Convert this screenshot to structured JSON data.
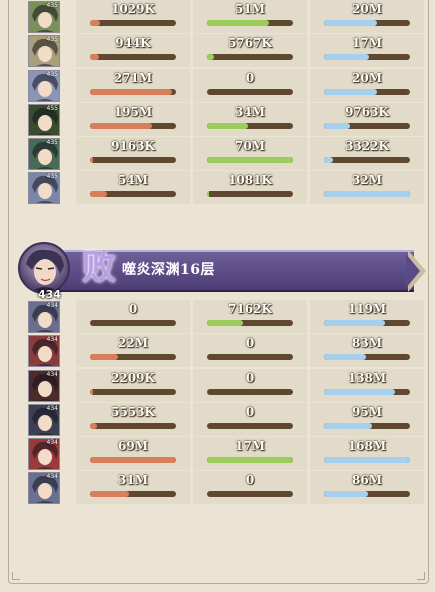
{
  "team_a": {
    "rows": [
      {
        "level": "435",
        "portrait_color": "#7b8f5a",
        "damage": {
          "value": "1029K",
          "fraction": 0.12
        },
        "healing": {
          "value": "51M",
          "fraction": 0.72
        },
        "taken": {
          "value": "20M",
          "fraction": 0.62
        }
      },
      {
        "level": "435",
        "portrait_color": "#a9a07a",
        "damage": {
          "value": "944K",
          "fraction": 0.1
        },
        "healing": {
          "value": "5767K",
          "fraction": 0.08
        },
        "taken": {
          "value": "17M",
          "fraction": 0.52
        }
      },
      {
        "level": "435",
        "portrait_color": "#8b95b8",
        "damage": {
          "value": "271M",
          "fraction": 0.95
        },
        "healing": {
          "value": "0",
          "fraction": 0
        },
        "taken": {
          "value": "20M",
          "fraction": 0.62
        }
      },
      {
        "level": "455",
        "portrait_color": "#3a4b2e",
        "damage": {
          "value": "195M",
          "fraction": 0.72
        },
        "healing": {
          "value": "34M",
          "fraction": 0.48
        },
        "taken": {
          "value": "9763K",
          "fraction": 0.3
        }
      },
      {
        "level": "435",
        "portrait_color": "#4a6a58",
        "damage": {
          "value": "9163K",
          "fraction": 0.03
        },
        "healing": {
          "value": "70M",
          "fraction": 1.0
        },
        "taken": {
          "value": "3322K",
          "fraction": 0.1
        }
      },
      {
        "level": "435",
        "portrait_color": "#7c87a8",
        "damage": {
          "value": "54M",
          "fraction": 0.2
        },
        "healing": {
          "value": "1081K",
          "fraction": 0.02
        },
        "taken": {
          "value": "32M",
          "fraction": 1.0
        }
      }
    ]
  },
  "banner": {
    "result": "败",
    "stage": "噬炎深渊16层",
    "level": "434",
    "accent": "#5a4a86"
  },
  "team_b": {
    "rows": [
      {
        "level": "434",
        "portrait_color": "#6b6e8f",
        "damage": {
          "value": "0",
          "fraction": 0
        },
        "healing": {
          "value": "7162K",
          "fraction": 0.42
        },
        "taken": {
          "value": "119M",
          "fraction": 0.71
        }
      },
      {
        "level": "434",
        "portrait_color": "#8a3c3c",
        "damage": {
          "value": "22M",
          "fraction": 0.32
        },
        "healing": {
          "value": "0",
          "fraction": 0
        },
        "taken": {
          "value": "83M",
          "fraction": 0.49
        }
      },
      {
        "level": "434",
        "portrait_color": "#4b2b2b",
        "damage": {
          "value": "2209K",
          "fraction": 0.03
        },
        "healing": {
          "value": "0",
          "fraction": 0
        },
        "taken": {
          "value": "138M",
          "fraction": 0.82
        }
      },
      {
        "level": "434",
        "portrait_color": "#3e3f52",
        "damage": {
          "value": "5553K",
          "fraction": 0.08
        },
        "healing": {
          "value": "0",
          "fraction": 0
        },
        "taken": {
          "value": "95M",
          "fraction": 0.56
        }
      },
      {
        "level": "434",
        "portrait_color": "#9b3a3a",
        "damage": {
          "value": "69M",
          "fraction": 1.0
        },
        "healing": {
          "value": "17M",
          "fraction": 1.0
        },
        "taken": {
          "value": "168M",
          "fraction": 1.0
        }
      },
      {
        "level": "434",
        "portrait_color": "#6a7090",
        "damage": {
          "value": "31M",
          "fraction": 0.45
        },
        "healing": {
          "value": "0",
          "fraction": 0
        },
        "taken": {
          "value": "86M",
          "fraction": 0.51
        }
      }
    ]
  },
  "colors": {
    "damage": "#d97e5b",
    "healing": "#9acd5a",
    "taken": "#a6d1ee",
    "bar_track": "#604830"
  }
}
